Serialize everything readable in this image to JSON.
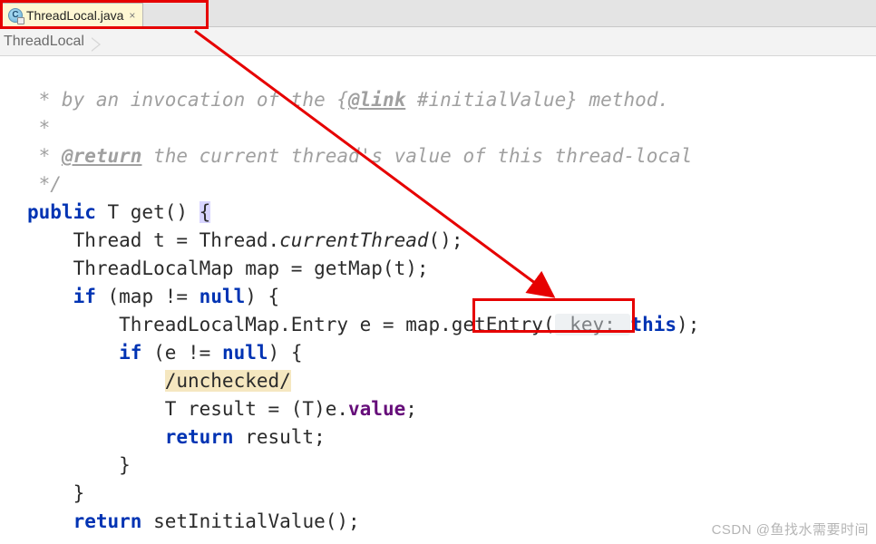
{
  "tab": {
    "label": "ThreadLocal.java",
    "icon_letter": "C",
    "close_glyph": "×"
  },
  "breadcrumb": {
    "item": "ThreadLocal"
  },
  "code": {
    "c1_a": " * by an invocation of the {",
    "c1_link": "@link",
    "c1_b": " #initialValue} method.",
    "c2": " *",
    "c3_a": " * ",
    "c3_tag": "@return",
    "c3_b": " the current thread's value of this thread-local",
    "c4": " */",
    "l1_public": "public",
    "l1_rest": " T get() ",
    "l1_brace": "{",
    "l2": "    Thread t = Thread.",
    "l2_call": "currentThread",
    "l2_end": "();",
    "l3": "    ThreadLocalMap map = getMap(t);",
    "l4_if": "if",
    "l4_rest": " (map != ",
    "l4_null": "null",
    "l4_end": ") {",
    "l5_a": "        ThreadLocalMap.Entry e = ",
    "l5_call": "map.getEntry",
    "l5_paren_open": "(",
    "l5_hint": " key: ",
    "l5_this": "this",
    "l5_paren_close": ");",
    "l6_if": "if",
    "l6_rest": " (e != ",
    "l6_null": "null",
    "l6_end": ") {",
    "l7_warn": "/unchecked/",
    "l8_a": "            T result = (T)e.",
    "l8_field": "value",
    "l8_end": ";",
    "l9_ret": "return",
    "l9_rest": " result;",
    "l10": "        }",
    "l11": "    }",
    "l12_ret": "return",
    "l12_rest": " setInitialValue();"
  },
  "watermark": "CSDN @鱼找水需要时间"
}
